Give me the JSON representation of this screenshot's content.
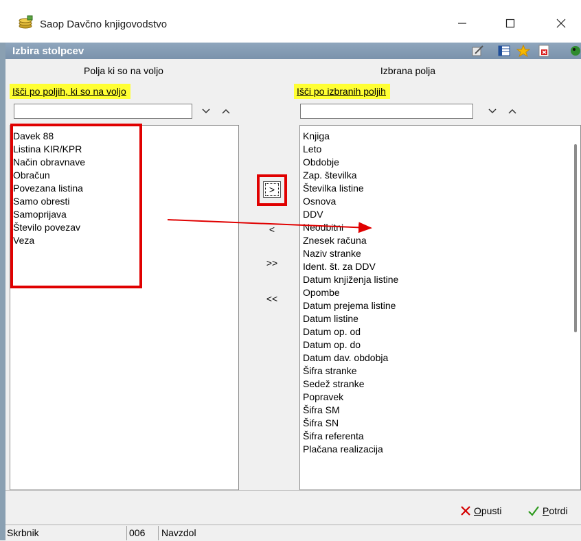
{
  "window": {
    "title": "Saop Davčno knjigovodstvo",
    "minimize_icon": "minimize-icon",
    "maximize_icon": "maximize-icon",
    "close_icon": "close-icon"
  },
  "dialog": {
    "title": "Izbira stolpcev",
    "header_icons": [
      "edit-icon",
      "columns-icon",
      "star-icon",
      "pdf-icon",
      "exit-icon"
    ]
  },
  "available": {
    "caption": "Polja ki so na voljo",
    "search_label": "Išči po poljih, ki so na voljo",
    "search_value": "",
    "items": [
      "Davek 88",
      "Listina KIR/KPR",
      "Način obravnave",
      "Obračun",
      "Povezana listina",
      "Samo obresti",
      "Samoprijava",
      "Število povezav",
      "Veza"
    ]
  },
  "selected": {
    "caption": "Izbrana polja",
    "search_label": "Išči po izbranih poljih",
    "search_value": "",
    "items": [
      "Knjiga",
      "Leto",
      "Obdobje",
      "Zap. številka",
      "Številka listine",
      "Osnova",
      "DDV",
      "Neodbitni",
      "Znesek računa",
      "Naziv stranke",
      "Ident. št. za DDV",
      "Datum knjiženja listine",
      "Opombe",
      "Datum prejema listine",
      "Datum listine",
      "Datum op. od",
      "Datum op. do",
      "Datum dav. obdobja",
      "Šifra stranke",
      "Sedež stranke",
      "Popravek",
      "Šifra SM",
      "Šifra SN",
      "Šifra referenta",
      "Plačana realizacija"
    ]
  },
  "move_buttons": {
    "add": ">",
    "remove": "<",
    "add_all": ">>",
    "remove_all": "<<"
  },
  "actions": {
    "cancel_label": "Opusti",
    "confirm_label": "Potrdi"
  },
  "status": {
    "user": "Skrbnik",
    "code": "006",
    "mode": "Navzdol"
  },
  "colors": {
    "highlight_yellow": "#ffff33",
    "annotation_red": "#e00000",
    "header_blue": "#7a92ab",
    "cancel_red": "#d40000",
    "confirm_green": "#2e9a1e"
  }
}
